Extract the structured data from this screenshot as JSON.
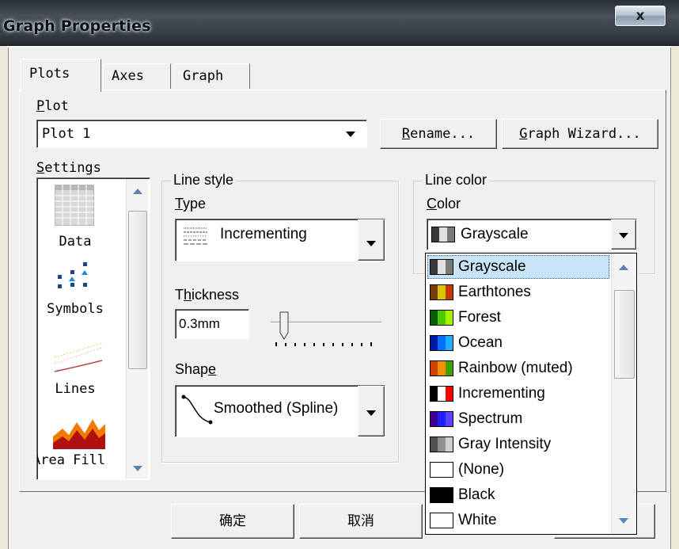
{
  "window": {
    "title": "Graph Properties",
    "close_glyph": "x"
  },
  "tabs": [
    {
      "label": "Plots",
      "selected": true
    },
    {
      "label": "Axes",
      "selected": false
    },
    {
      "label": "Graph",
      "selected": false
    }
  ],
  "plot": {
    "label_accel": "P",
    "label_rest": "lot",
    "selected": "Plot 1",
    "rename_accel": "R",
    "rename_rest": "ename...",
    "wizard_accel": "G",
    "wizard_rest": "raph Wizard..."
  },
  "settings": {
    "label_accel": "S",
    "label_rest": "ettings",
    "items": [
      {
        "label": "Data",
        "icon": "data-table-icon"
      },
      {
        "label": "Symbols",
        "icon": "symbols-icon"
      },
      {
        "label": "Lines",
        "icon": "lines-icon",
        "selected": true
      },
      {
        "label": "Area Fill",
        "icon": "area-fill-icon"
      }
    ]
  },
  "line_style": {
    "legend": "Line style",
    "type_label_accel": "T",
    "type_label_rest": "ype",
    "type_value": "Incrementing",
    "thickness_label_pre": "T",
    "thickness_label_accel": "h",
    "thickness_label_rest": "ickness",
    "thickness_value": "0.3mm",
    "shape_label_pre": "Shap",
    "shape_label_accel": "e",
    "shape_value": "Smoothed (Spline)"
  },
  "line_color": {
    "legend": "Line color",
    "color_label_accel": "C",
    "color_label_rest": "olor",
    "selected": "Grayscale",
    "options": [
      {
        "label": "Grayscale",
        "colors": [
          "#3a3a3a",
          "#e0e0e0",
          "#7a7a7a"
        ],
        "highlighted": true
      },
      {
        "label": "Earthtones",
        "colors": [
          "#7a3b10",
          "#d8c400",
          "#c23a00"
        ]
      },
      {
        "label": "Forest",
        "colors": [
          "#0a5a0a",
          "#4ac800",
          "#a8f000"
        ]
      },
      {
        "label": "Ocean",
        "colors": [
          "#0018a0",
          "#0070ff",
          "#20b0ff"
        ]
      },
      {
        "label": "Rainbow (muted)",
        "colors": [
          "#d04000",
          "#f09000",
          "#40a000"
        ]
      },
      {
        "label": "Incrementing",
        "colors": [
          "#000000",
          "#ffffff",
          "#ff0000"
        ]
      },
      {
        "label": "Spectrum",
        "colors": [
          "#400090",
          "#2020ff",
          "#6040ff"
        ]
      },
      {
        "label": "Gray Intensity",
        "colors": [
          "#505050",
          "#909090",
          "#d0d0d0"
        ]
      },
      {
        "label": "(None)",
        "colors": [
          "#ffffff",
          "#ffffff",
          "#ffffff"
        ]
      },
      {
        "label": "Black",
        "colors": [
          "#000000",
          "#000000",
          "#000000"
        ]
      },
      {
        "label": "White",
        "colors": [
          "#ffffff",
          "#ffffff",
          "#ffffff"
        ]
      }
    ]
  },
  "buttons": {
    "ok": "确定",
    "cancel": "取消"
  },
  "colors": {
    "highlight": "#c8e4f8",
    "dialog_bg": "#f0f0f0",
    "scroll_arrow": "#5a84b8"
  }
}
